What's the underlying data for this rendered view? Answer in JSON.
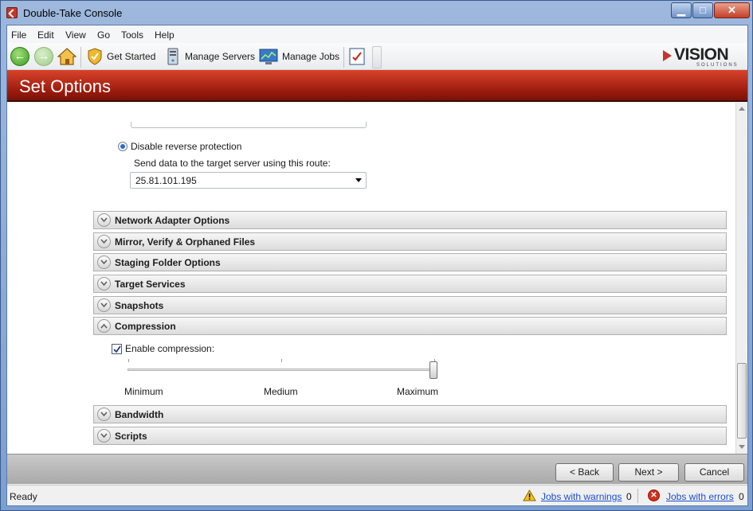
{
  "window": {
    "title": "Double-Take Console",
    "minimize": "▁",
    "maximize": "□",
    "close": "✕"
  },
  "menu": [
    "File",
    "Edit",
    "View",
    "Go",
    "Tools",
    "Help"
  ],
  "toolbar": {
    "get_started": "Get Started",
    "manage_servers": "Manage Servers",
    "manage_jobs": "Manage Jobs"
  },
  "logo": {
    "main": "VISION",
    "sub": "SOLUTIONS"
  },
  "banner": {
    "title": "Set Options"
  },
  "route": {
    "disable_reverse_label": "Disable reverse protection",
    "disable_reverse_selected": true,
    "route_label": "Send data to the target server using this route:",
    "route_value": "25.81.101.195"
  },
  "sections": {
    "network_adapter": "Network Adapter Options",
    "mirror_verify": "Mirror, Verify & Orphaned Files",
    "staging_folder": "Staging Folder Options",
    "target_services": "Target Services",
    "snapshots": "Snapshots",
    "compression": "Compression",
    "bandwidth": "Bandwidth",
    "scripts": "Scripts"
  },
  "compression": {
    "enable_label": "Enable compression:",
    "enabled": true,
    "min_label": "Minimum",
    "medium_label": "Medium",
    "max_label": "Maximum",
    "level": "Maximum"
  },
  "buttons": {
    "back": "< Back",
    "next": "Next >",
    "cancel": "Cancel"
  },
  "status": {
    "text": "Ready",
    "warnings_label": "Jobs with warnings",
    "warnings_count": "0",
    "errors_label": "Jobs with errors",
    "errors_count": "0"
  },
  "colors": {
    "banner": "#b52a17",
    "link": "#1a4ed0",
    "radio": "#2a6ad6"
  }
}
